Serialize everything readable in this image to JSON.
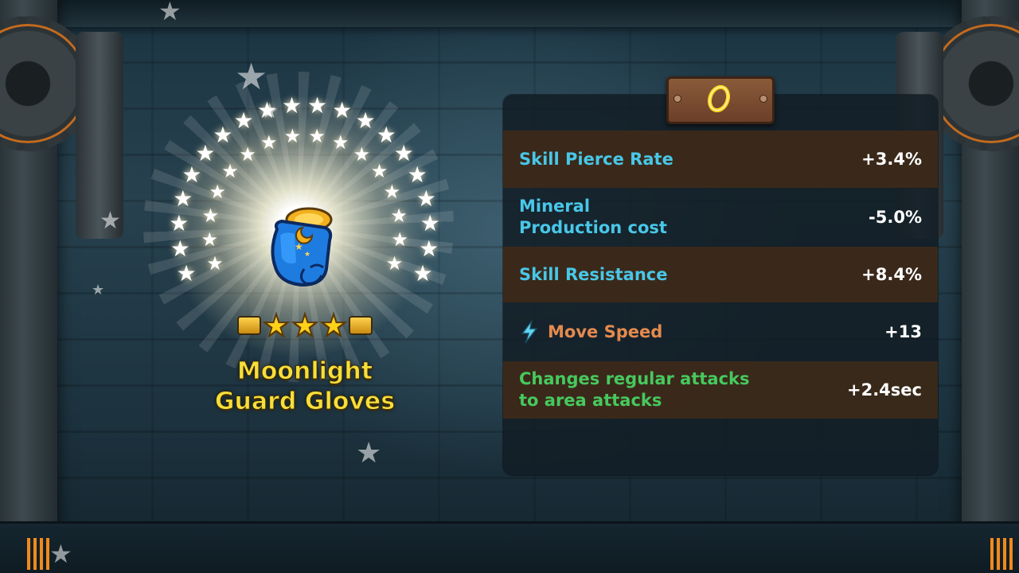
{
  "item": {
    "name_line1": "Moonlight",
    "name_line2": "Guard Gloves",
    "star_rating": 3,
    "icon": "blue-glove-icon"
  },
  "panel": {
    "plaque_icon": "gold-ring-icon",
    "stats": [
      {
        "label_line1": "Skill Pierce Rate",
        "label_line2": "",
        "value": "+3.4%",
        "color": "#48c7e8"
      },
      {
        "label_line1": "Mineral",
        "label_line2": "Production cost",
        "value": "-5.0%",
        "color": "#48c7e8"
      },
      {
        "label_line1": "Skill Resistance",
        "label_line2": "",
        "value": "+8.4%",
        "color": "#48c7e8"
      },
      {
        "label_line1": "Move Speed",
        "label_line2": "",
        "value": "+13",
        "color": "#e58a4e",
        "icon": "lightning-bolt-icon"
      },
      {
        "label_line1": "Changes regular attacks",
        "label_line2": "to area attacks",
        "value": "+2.4sec",
        "color": "#46c95e"
      }
    ]
  },
  "colors": {
    "accent_gold": "#f7df3a",
    "stat_cyan": "#48c7e8",
    "stat_orange": "#e58a4e",
    "stat_green": "#46c95e"
  }
}
